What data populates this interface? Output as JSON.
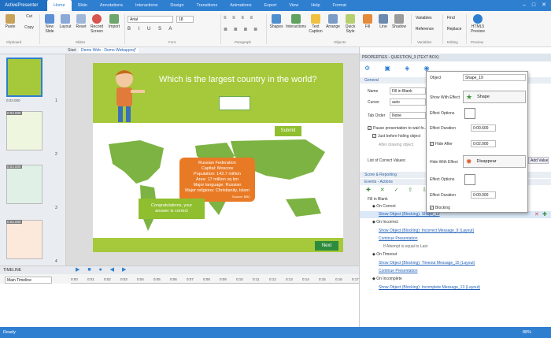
{
  "app": {
    "menu_label": "ActivePresenter",
    "status": "Ready",
    "zoom": "88%"
  },
  "tabs": [
    "Home",
    "Slide",
    "Annotations",
    "Interactions",
    "Design",
    "Transitions",
    "Animations",
    "Export",
    "View",
    "Help",
    "Format"
  ],
  "ribbon": {
    "buttons": [
      "Paste",
      "Cut",
      "Copy",
      "New Slide",
      "Layout",
      "Reset",
      "Record Screen",
      "Import",
      "Shapes",
      "Interactions",
      "Text Caption",
      "Arrange",
      "Quick Style",
      "Fill",
      "Line",
      "Shadow",
      "Variables",
      "Reference",
      "Find",
      "Replace",
      "HTML5 Preview"
    ],
    "font_name": "Arial",
    "font_size": "18",
    "groups": [
      "Clipboard",
      "Slides",
      "Font",
      "Paragraph",
      "Objects",
      "Variables",
      "Editing",
      "Preview"
    ]
  },
  "doc_tabs": [
    "Start",
    "Demo Web - Demo Webapproj*"
  ],
  "thumbs": [
    "1",
    "2",
    "3",
    "4",
    "5"
  ],
  "thumb_durations": [
    "0:03.000",
    "0:03.000",
    "0:03.000",
    "0:03.000",
    "0:03.000"
  ],
  "slide": {
    "title": "Which is the largest country in the world?",
    "submit": "Submit",
    "bubble": [
      "Russian Federation",
      "Capital: Moscow",
      "Population: 142.7 million",
      "Area: 17 million sq km",
      "Major language: Russian",
      "Major religions: Christianity, Islam",
      "Source: BBC"
    ],
    "congrats": [
      "Congratulations, your",
      "answer is correct"
    ],
    "next": "Next"
  },
  "timeline": {
    "title": "TIMELINE",
    "track": "Main Timeline",
    "ticks": [
      "0:00",
      "0:01",
      "0:02",
      "0:03",
      "0:04",
      "0:05",
      "0:06",
      "0:07",
      "0:08",
      "0:09",
      "0:10",
      "0:11",
      "0:12",
      "0:13",
      "0:14",
      "0:15",
      "0:16",
      "0:17"
    ]
  },
  "props": {
    "title": "PROPERTIES - QUESTION_3 (TEXT BOX)",
    "general": "General",
    "name_label": "Name",
    "name_value": "Fill in Blank",
    "cursor_label": "Cursor",
    "cursor_value": "auto",
    "taborder_label": "Tab Order",
    "taborder_value": "None",
    "pause_label": "Pause presentation to wait fo...",
    "before_hiding": "Just before hiding object",
    "after_drawing": "After drawing object",
    "correct_values": "List of Correct Values:",
    "add_value": "Add Value",
    "score": "Score & Reporting",
    "events": "Events - Actions",
    "event_group": "Fill in Blank",
    "rows": [
      {
        "kind": "event",
        "text": "On Correct"
      },
      {
        "kind": "link",
        "text": "Show Object (Blocking): Shape_19"
      },
      {
        "kind": "event",
        "text": "On Incorrect"
      },
      {
        "kind": "link",
        "text": "Show Object (Blocking): Incorrect Message_9 (Layout)"
      },
      {
        "kind": "link",
        "text": "Continue Presentation"
      },
      {
        "kind": "note",
        "text": "If Attempt is equal to Last"
      },
      {
        "kind": "event",
        "text": "On Timeout"
      },
      {
        "kind": "link",
        "text": "Show Object (Blocking): Timeout Message_15 (Layout)"
      },
      {
        "kind": "link",
        "text": "Continue Presentation"
      },
      {
        "kind": "event",
        "text": "On Incomplete"
      },
      {
        "kind": "link",
        "text": "Show Object (Blocking): Incomplete Message_13 (Layout)"
      }
    ]
  },
  "popup": {
    "object_label": "Object",
    "object_value": "Shape_19",
    "show_effect": "Show With Effect",
    "show_effect_value": "Shape",
    "effect_options": "Effect Options",
    "effect_duration": "Effect Duration",
    "show_duration": "0:00.600",
    "hide_after": "Hide After",
    "hide_after_value": "0:02.000",
    "hide_effect": "Hide With Effect",
    "hide_effect_value": "Disappear",
    "effect_options2": "Effect Options",
    "effect_duration2": "Effect Duration",
    "hide_duration": "0:00.000",
    "blocking": "Blocking"
  }
}
